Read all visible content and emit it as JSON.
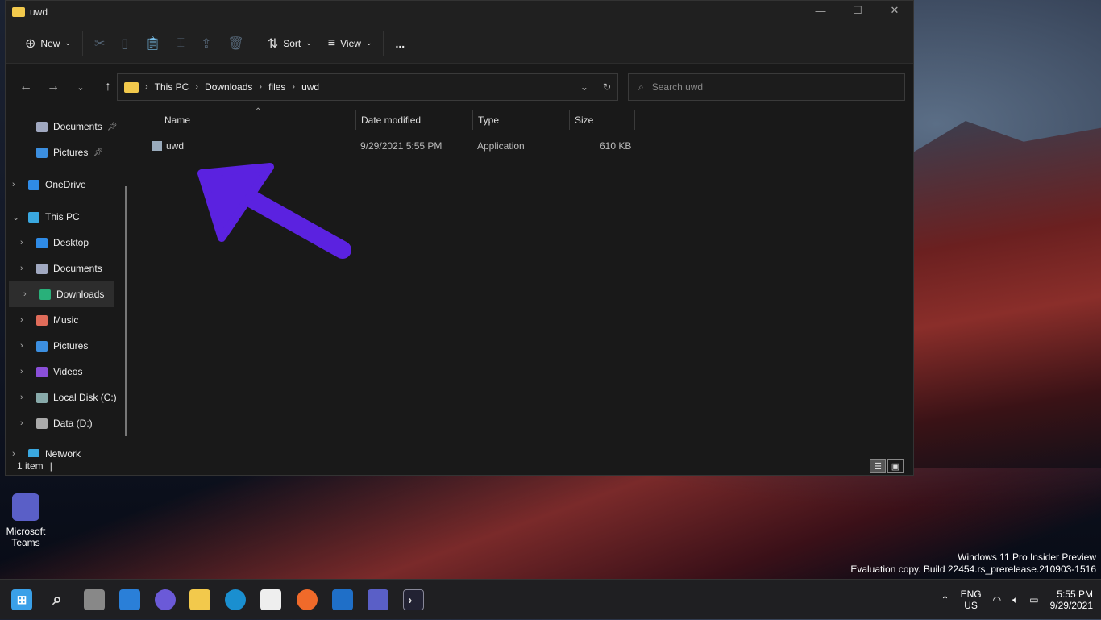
{
  "window": {
    "title": "uwd"
  },
  "toolbar": {
    "new": "New",
    "sort": "Sort",
    "view": "View",
    "more": "..."
  },
  "address": {
    "crumbs": [
      "This PC",
      "Downloads",
      "files",
      "uwd"
    ],
    "search_placeholder": "Search uwd"
  },
  "sidebar": {
    "items": [
      {
        "label": "Documents",
        "icon": "documents-icon",
        "pinned": true,
        "color": "#a0a8c0"
      },
      {
        "label": "Pictures",
        "icon": "pictures-icon",
        "pinned": true,
        "color": "#3c8fe0"
      },
      {
        "label": "OneDrive",
        "icon": "onedrive-icon",
        "color": "#2f8be6"
      },
      {
        "label": "This PC",
        "icon": "computer-icon",
        "color": "#3aa8e0"
      },
      {
        "label": "Desktop",
        "icon": "desktop-icon",
        "color": "#2f8be6"
      },
      {
        "label": "Documents",
        "icon": "documents-icon",
        "color": "#a0a8c0"
      },
      {
        "label": "Downloads",
        "icon": "download-icon",
        "color": "#29b07a",
        "selected": true
      },
      {
        "label": "Music",
        "icon": "music-icon",
        "color": "#e06c5a"
      },
      {
        "label": "Pictures",
        "icon": "pictures-icon",
        "color": "#3c8fe0"
      },
      {
        "label": "Videos",
        "icon": "videos-icon",
        "color": "#8a4fd8"
      },
      {
        "label": "Local Disk (C:)",
        "icon": "drive-icon",
        "color": "#8aa"
      },
      {
        "label": "Data (D:)",
        "icon": "drive-icon",
        "color": "#aaa"
      },
      {
        "label": "Network",
        "icon": "network-icon",
        "color": "#3aa8e0"
      }
    ]
  },
  "columns": [
    "Name",
    "Date modified",
    "Type",
    "Size"
  ],
  "files": [
    {
      "name": "uwd",
      "date": "9/29/2021 5:55 PM",
      "type": "Application",
      "size": "610 KB"
    }
  ],
  "status": {
    "count": "1 item"
  },
  "desktop": {
    "icon_label": "Microsoft Teams"
  },
  "watermark": {
    "line1": "Windows 11 Pro Insider Preview",
    "line2": "Evaluation copy. Build 22454.rs_prerelease.210903-1516"
  },
  "tray": {
    "lang1": "ENG",
    "lang2": "US",
    "time": "5:55 PM",
    "date": "9/29/2021"
  },
  "annotation": {
    "arrow_color": "#5b22e0"
  }
}
